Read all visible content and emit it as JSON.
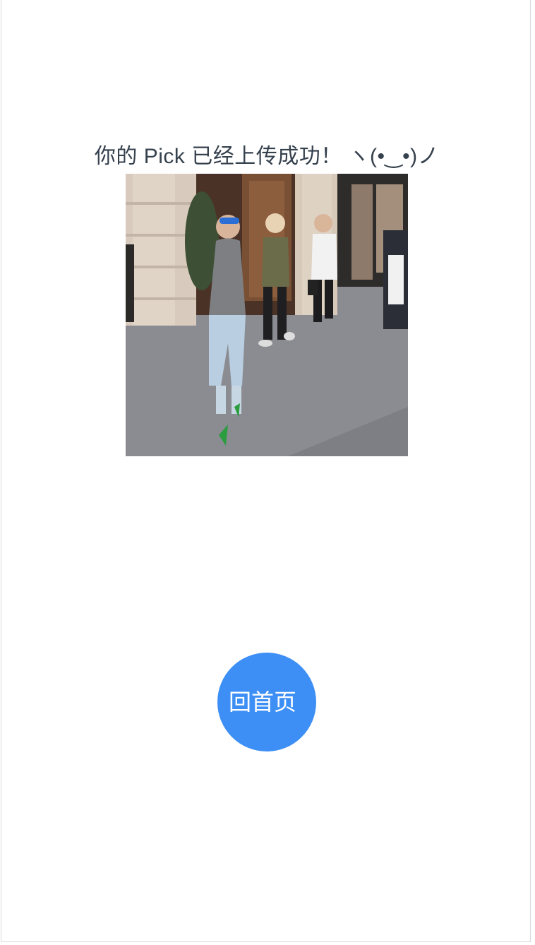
{
  "page": {
    "success_message": "你的 Pick 已经上传成功！ ヽ(•‿•)ノ",
    "home_button_label": "回首页"
  },
  "image": {
    "description": "",
    "alt": ""
  },
  "colors": {
    "title_text": "#35414d",
    "home_button_bg": "#3d8ff5",
    "home_button_text": "#ffffff",
    "page_bg": "#ffffff",
    "frame_border": "#d9d9d9"
  }
}
